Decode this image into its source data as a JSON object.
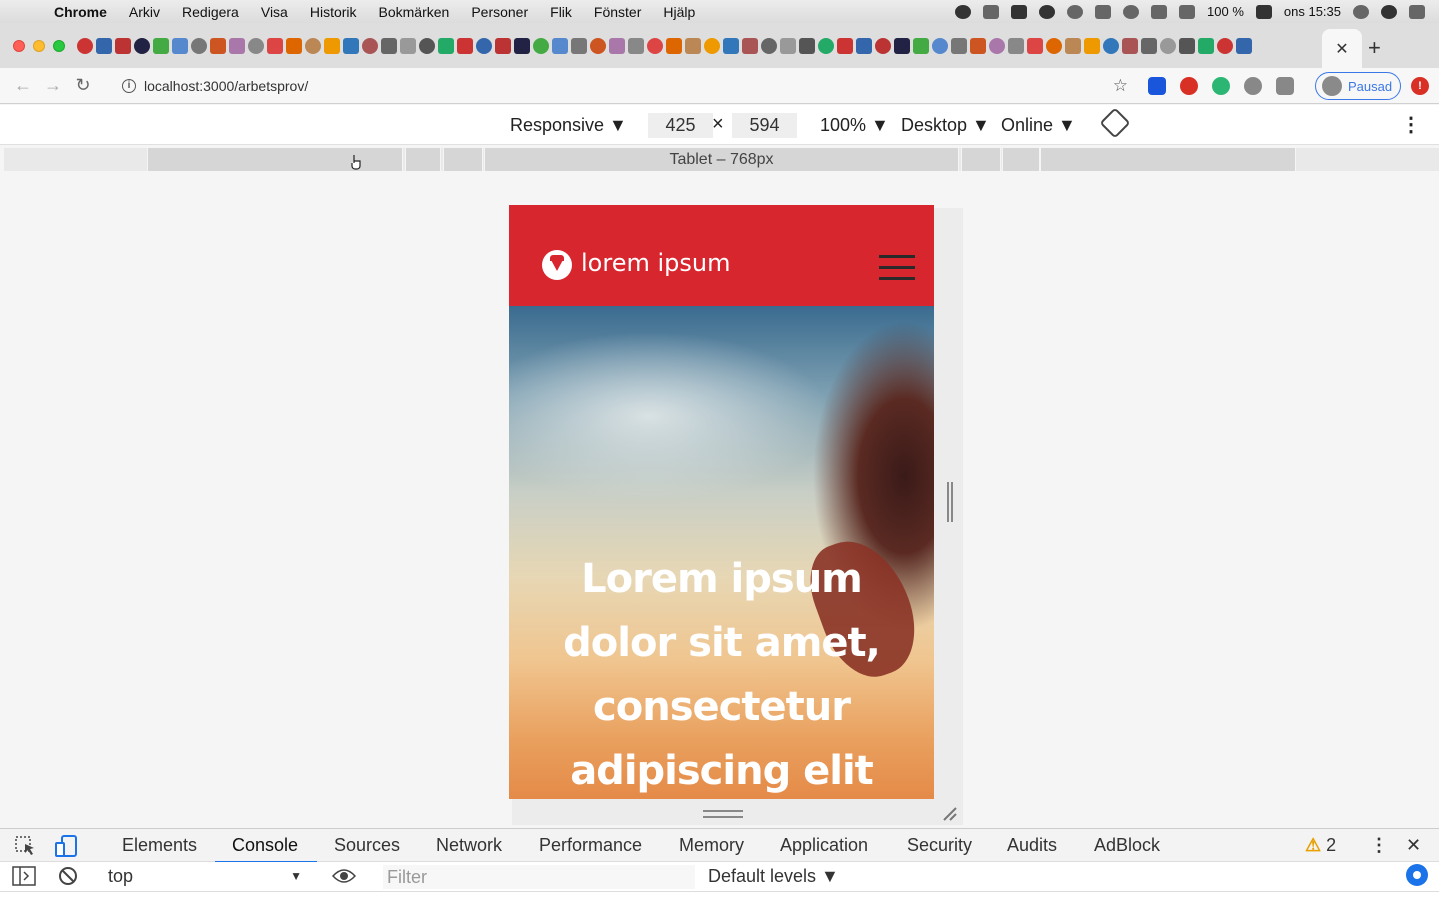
{
  "menubar": {
    "app": "Chrome",
    "items": [
      "Arkiv",
      "Redigera",
      "Visa",
      "Historik",
      "Bokmärken",
      "Personer",
      "Flik",
      "Fönster",
      "Hjälp"
    ],
    "battery": "100 %",
    "clock": "ons 15:35"
  },
  "tab": {
    "close_glyph": "✕",
    "new_tab_glyph": "+"
  },
  "toolbar": {
    "back": "←",
    "forward": "→",
    "reload": "↻",
    "url": "localhost:3000/arbetsprov/",
    "star": "☆",
    "profile_label": "Pausad"
  },
  "device_toolbar": {
    "mode": "Responsive ▼",
    "width": "425",
    "times": "×",
    "height": "594",
    "zoom": "100% ▼",
    "device_type": "Desktop ▼",
    "throttling": "Online ▼",
    "more": "⋮"
  },
  "media_query": {
    "label": "Tablet – 768px"
  },
  "site": {
    "brand": "lorem ipsum",
    "hero_title": "Lorem ipsum dolor sit amet, consectetur adipiscing elit",
    "header_color": "#d8262e"
  },
  "devtools": {
    "tabs": [
      "Elements",
      "Console",
      "Sources",
      "Network",
      "Performance",
      "Memory",
      "Application",
      "Security",
      "Audits",
      "AdBlock"
    ],
    "active_tab": "Console",
    "warning_count": "2",
    "close": "✕",
    "more": "⋮",
    "context": "top",
    "filter_placeholder": "Filter",
    "levels": "Default levels ▼"
  }
}
